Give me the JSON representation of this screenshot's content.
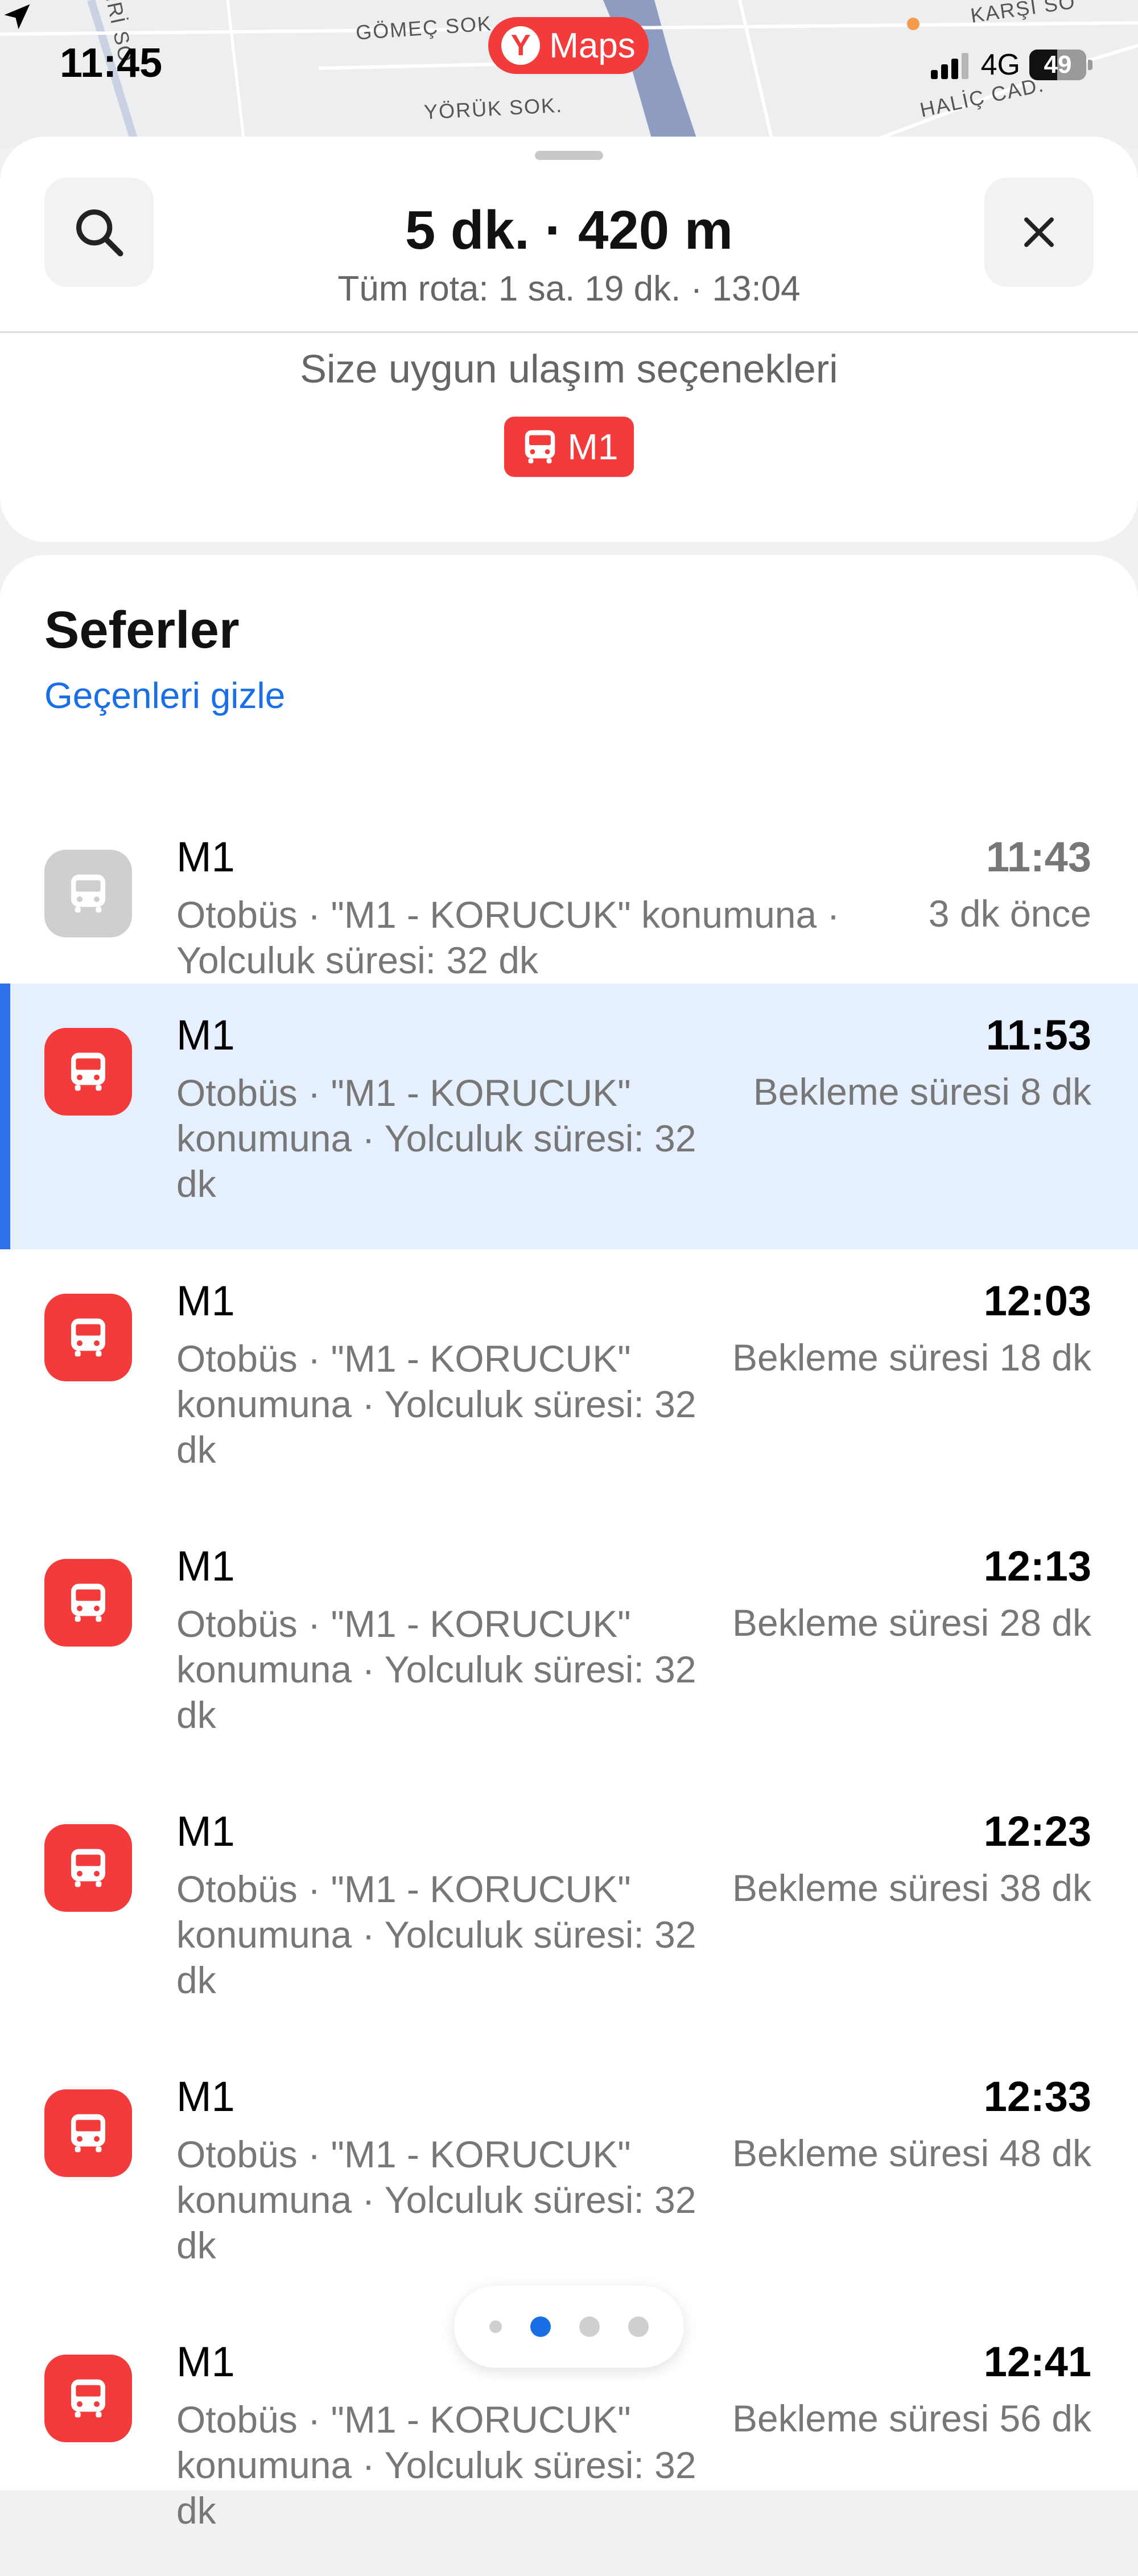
{
  "status_bar": {
    "time": "11:45",
    "network": "4G",
    "battery": "49"
  },
  "map": {
    "streets": [
      "GÖMEÇ SOK.",
      "YÖRÜK SOK.",
      "HALİÇ CAD.",
      "KARŞI SO",
      "İRİ SO"
    ]
  },
  "app_badge": {
    "logo_letter": "Y",
    "label": "Maps"
  },
  "route_header": {
    "title": "5 dk. · 420 m",
    "subtitle": "Tüm rota: 1 sa. 19 dk. · 13:04",
    "options_title": "Size uygun ulaşım seçenekleri",
    "route_chip": "M1"
  },
  "trips": {
    "title": "Seferler",
    "hide_past_link": "Geçenleri gizle",
    "items": [
      {
        "line": "M1",
        "description": "Otobüs · \"M1 - KORUCUK\" konumuna · Yolculuk süresi: 32 dk",
        "time": "11:43",
        "status": "3 dk önce",
        "past": true
      },
      {
        "line": "M1",
        "description": "Otobüs · \"M1 - KORUCUK\" konumuna · Yolculuk süresi: 32 dk",
        "time": "11:53",
        "status": "Bekleme süresi 8 dk",
        "selected": true
      },
      {
        "line": "M1",
        "description": "Otobüs · \"M1 - KORUCUK\" konumuna · Yolculuk süresi: 32 dk",
        "time": "12:03",
        "status": "Bekleme süresi 18 dk"
      },
      {
        "line": "M1",
        "description": "Otobüs · \"M1 - KORUCUK\" konumuna · Yolculuk süresi: 32 dk",
        "time": "12:13",
        "status": "Bekleme süresi 28 dk"
      },
      {
        "line": "M1",
        "description": "Otobüs · \"M1 - KORUCUK\" konumuna · Yolculuk süresi: 32 dk",
        "time": "12:23",
        "status": "Bekleme süresi 38 dk"
      },
      {
        "line": "M1",
        "description": "Otobüs · \"M1 - KORUCUK\" konumuna · Yolculuk süresi: 32 dk",
        "time": "12:33",
        "status": "Bekleme süresi 48 dk"
      },
      {
        "line": "M1",
        "description": "Otobüs · \"M1 - KORUCUK\" konumuna · Yolculuk süresi: 32 dk",
        "time": "12:41",
        "status": "Bekleme süresi 56 dk"
      }
    ]
  },
  "pager": {
    "count": 4,
    "active_index": 1
  },
  "colors": {
    "accent_red": "#f43b3b",
    "link_blue": "#1a6ee6",
    "selected_bg": "#e6effd",
    "selected_bar": "#2f6fea"
  },
  "icons": {
    "search": "search-icon",
    "close": "close-icon",
    "bus": "bus-icon",
    "location": "location-arrow-icon"
  }
}
